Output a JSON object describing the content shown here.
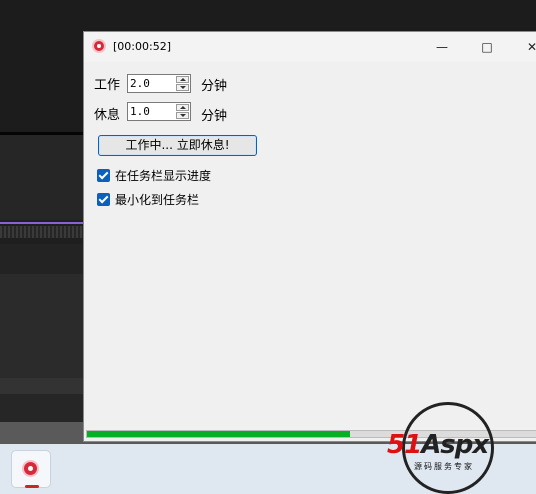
{
  "window": {
    "title": "[00:00:52]"
  },
  "work": {
    "label": "工作",
    "value": "2.0",
    "unit": "分钟"
  },
  "rest": {
    "label": "休息",
    "value": "1.0",
    "unit": "分钟"
  },
  "action_button": "工作中... 立即休息!",
  "options": [
    {
      "label": "在任务栏显示进度",
      "checked": true
    },
    {
      "label": "最小化到任务栏",
      "checked": true
    }
  ],
  "progress": {
    "fraction": 0.58,
    "color": "#06b025"
  },
  "watermark": {
    "brand_51": "51",
    "brand_aspx": "Aspx",
    "subtitle": "源码服务专家"
  },
  "icons": [
    "app-timer-icon",
    "minimize-icon",
    "maximize-icon",
    "close-icon",
    "spin-up-icon",
    "spin-down-icon",
    "checkbox-checked-icon"
  ]
}
